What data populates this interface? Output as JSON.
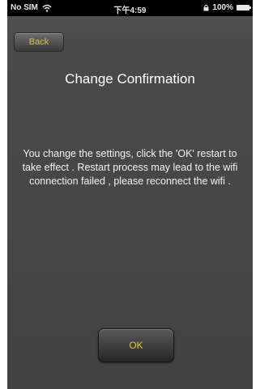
{
  "status_bar": {
    "carrier": "No SIM",
    "wifi_icon": "wifi-icon",
    "time": "下午4:59",
    "lock_icon": "lock-icon",
    "battery_percent": "100%",
    "battery_icon": "battery-icon"
  },
  "nav": {
    "back_label": "Back"
  },
  "dialog": {
    "title": "Change Confirmation",
    "message": "You change the settings, click the 'OK' restart to take effect . Restart process may lead to the wifi connection failed , please reconnect the wifi .",
    "ok_label": "OK"
  },
  "colors": {
    "accent_text": "#d9c23a",
    "background": "#454545"
  }
}
